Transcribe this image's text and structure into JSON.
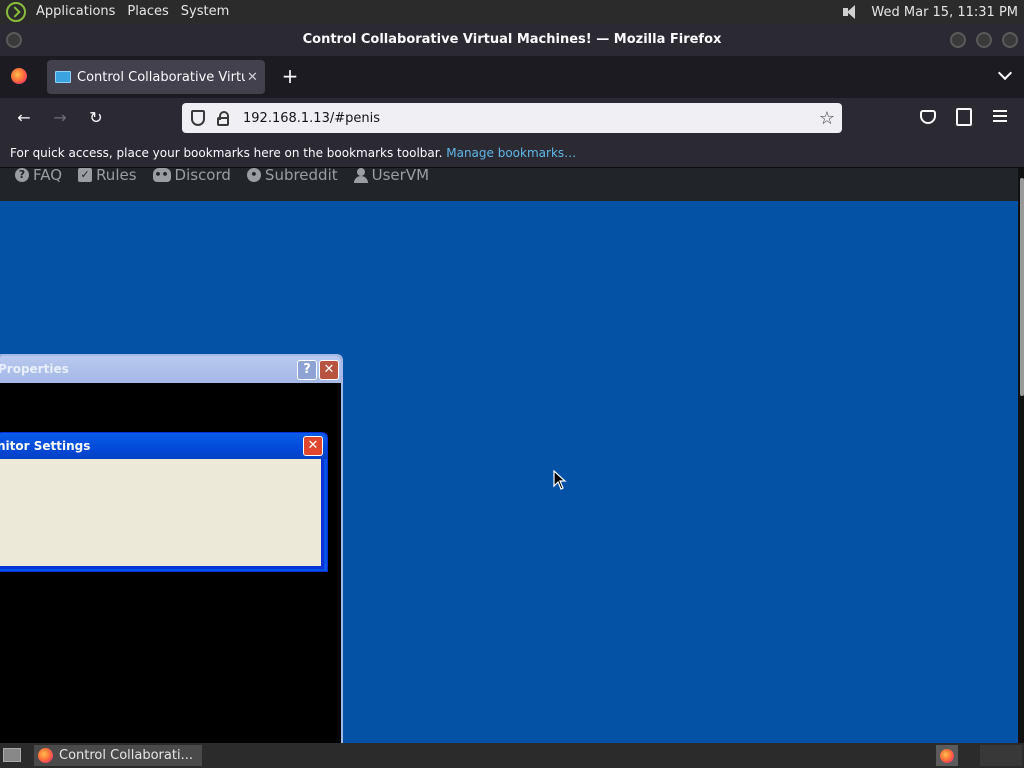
{
  "top_panel": {
    "menus": [
      "Applications",
      "Places",
      "System"
    ],
    "clock": "Wed Mar 15, 11:31 PM"
  },
  "window": {
    "title": "Control Collaborative Virtual Machines! — Mozilla Firefox"
  },
  "tab": {
    "title": "Control Collaborative Virtual Machines!",
    "close": "✕",
    "new_tab": "+"
  },
  "navbar": {
    "back": "←",
    "forward": "→",
    "reload": "↻",
    "url": "192.168.1.13/#penis",
    "star": "☆"
  },
  "bookmarks_bar": {
    "message": "For quick access, place your bookmarks here on the bookmarks toolbar.",
    "manage_link": "Manage bookmarks…"
  },
  "site_nav": {
    "items": [
      {
        "label": "FAQ",
        "icon": "question-icon"
      },
      {
        "label": "Rules",
        "icon": "check-icon"
      },
      {
        "label": "Discord",
        "icon": "discord-icon"
      },
      {
        "label": "Subreddit",
        "icon": "reddit-icon"
      },
      {
        "label": "UserVM",
        "icon": "user-icon"
      }
    ]
  },
  "vm_screen": {
    "desktop_color": "#0352a6",
    "properties_window": {
      "title": "Properties",
      "help": "?",
      "close": "✕"
    },
    "monitor_settings_dialog": {
      "title": "nitor Settings",
      "close": "✕"
    }
  },
  "taskbar": {
    "item_label": "Control Collaborati..."
  }
}
